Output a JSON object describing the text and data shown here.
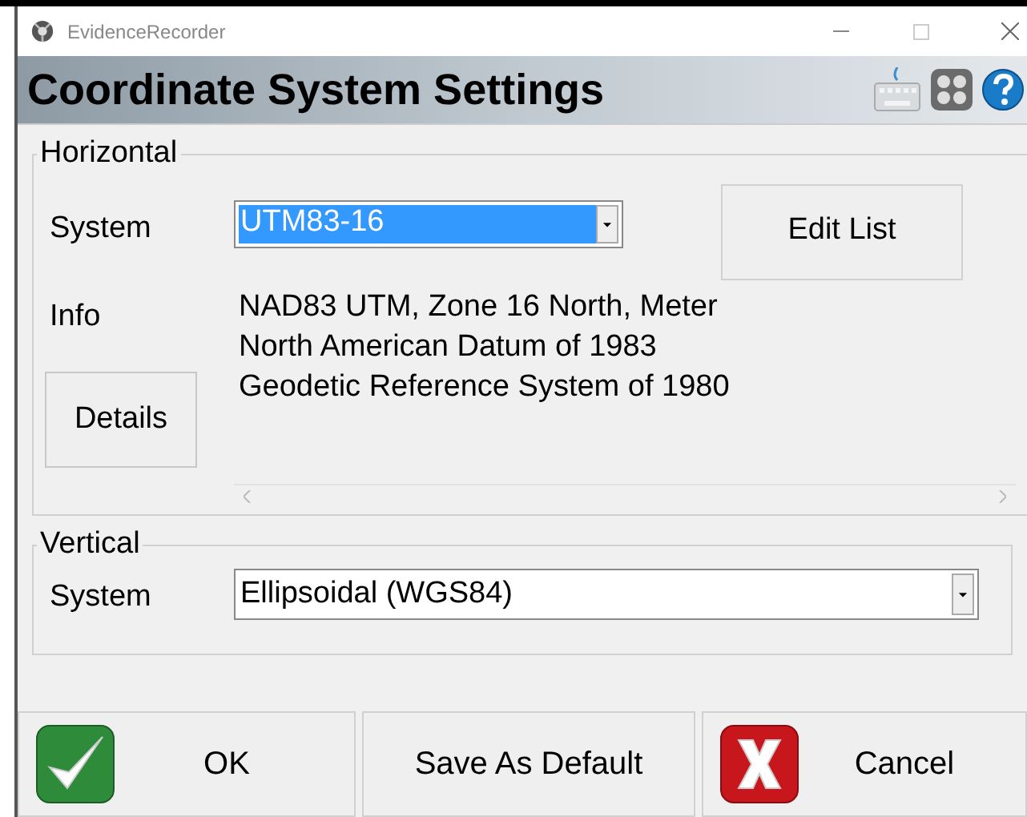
{
  "window": {
    "title": "EvidenceRecorder"
  },
  "header": {
    "title": "Coordinate System Settings"
  },
  "horizontal": {
    "legend": "Horizontal",
    "system_label": "System",
    "system": {
      "value": "UTM83-16",
      "highlighted": true
    },
    "edit_button": "Edit List",
    "info_label": "Info",
    "info_lines": [
      "NAD83 UTM, Zone 16 North, Meter",
      "North American Datum of 1983",
      "Geodetic Reference System of 1980"
    ],
    "details_button": "Details"
  },
  "vertical": {
    "legend": "Vertical",
    "system_label": "System",
    "system": {
      "value": "Ellipsoidal (WGS84)",
      "highlighted": false
    }
  },
  "buttons": [
    {
      "label": "OK",
      "kind": "ok"
    },
    {
      "label": "Save As Default",
      "kind": "plain"
    },
    {
      "label": "Cancel",
      "kind": "cancel"
    }
  ]
}
